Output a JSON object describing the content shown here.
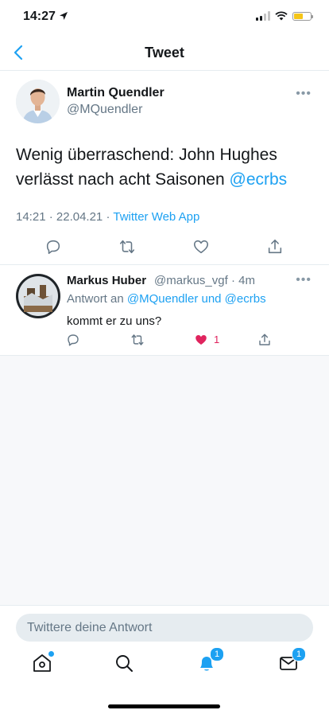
{
  "status": {
    "time": "14:27",
    "battery_color": "#f5c518"
  },
  "nav": {
    "title": "Tweet",
    "back_icon": "chevron-left-icon"
  },
  "tweet": {
    "author_name": "Martin Quendler",
    "author_handle": "@MQuendler",
    "text": "Wenig überraschend: John Hughes verlässt nach acht Saisonen",
    "mention": "@ecrbs",
    "time": "14:21",
    "date": "22.04.21",
    "source": "Twitter Web App",
    "separator": "·"
  },
  "reply": {
    "author_name": "Markus Huber",
    "author_handle": "@markus_vgf",
    "age": "4m",
    "context_prefix": "Antwort an",
    "context_mentions": "@MQuendler und @ecrbs",
    "text": "kommt er zu uns?",
    "like_count": "1",
    "liked": true
  },
  "compose": {
    "placeholder": "Twittere deine Antwort"
  },
  "tabbar": {
    "notifications_badge": "1",
    "messages_badge": "1"
  },
  "colors": {
    "accent": "#1da1f2",
    "like": "#e0245e",
    "muted": "#657786"
  }
}
